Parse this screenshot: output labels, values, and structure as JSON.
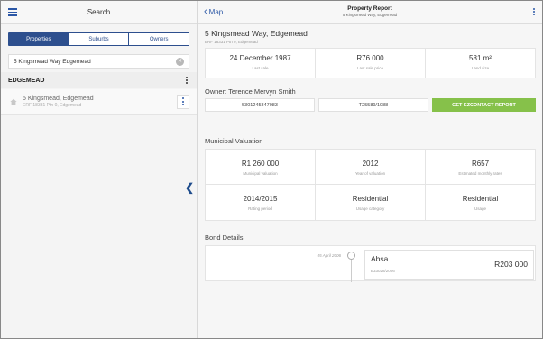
{
  "left_panel": {
    "title": "Search",
    "tabs": [
      {
        "label": "Properties",
        "active": true
      },
      {
        "label": "Suburbs",
        "active": false
      },
      {
        "label": "Owners",
        "active": false
      }
    ],
    "search": {
      "value": "5 Kingsmead Way Edgemead",
      "placeholder": ""
    },
    "group": {
      "title": "EDGEMEAD"
    },
    "results": [
      {
        "title": "5 Kingsmead, Edgemead",
        "subtitle": "ERF 18331 Ptn 0, Edgemead"
      }
    ]
  },
  "header": {
    "back_label": "Map",
    "title": "Property Report",
    "subtitle": "5 Kingsmead Way, Edgemead"
  },
  "property": {
    "address": "5 Kingsmead Way, Edgemead",
    "erf": "ERF 18331 Ptn 0, Edgemead",
    "sale": [
      {
        "value": "24 December 1987",
        "label": "Last sale"
      },
      {
        "value": "R76 000",
        "label": "Last sale price"
      },
      {
        "value": "581 m²",
        "label": "Land size"
      }
    ]
  },
  "owner": {
    "label": "Owner: Terence Mervyn Smith",
    "id_number": "5301245847083",
    "deed_number": "T25589/1988",
    "button_label": "GET EZCONTACT REPORT"
  },
  "valuation": {
    "label": "Municipal Valuation",
    "rows": [
      [
        {
          "value": "R1 260 000",
          "label": "Municipal valuation"
        },
        {
          "value": "2012",
          "label": "Year of valuation"
        },
        {
          "value": "R657",
          "label": "Estimated monthly rates"
        }
      ],
      [
        {
          "value": "2014/2015",
          "label": "Rating period"
        },
        {
          "value": "Residential",
          "label": "Usage category"
        },
        {
          "value": "Residential",
          "label": "Usage"
        }
      ]
    ]
  },
  "bond": {
    "label": "Bond Details",
    "date": "05 April 2006",
    "bank": "Absa",
    "reference": "B33028/2006",
    "amount": "R203 000"
  },
  "colors": {
    "accent": "#2b57a6",
    "segment": "#2d4f8e",
    "button_green": "#86c14a"
  }
}
